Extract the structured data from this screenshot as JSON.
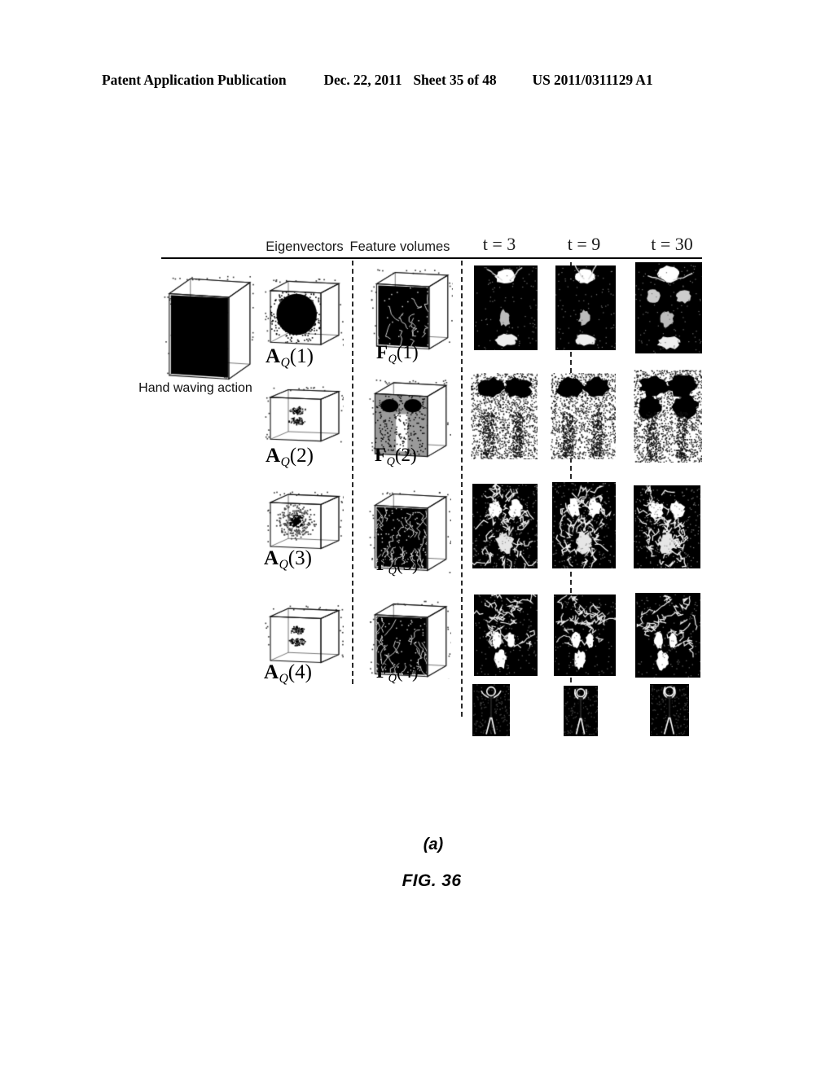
{
  "header": {
    "publication": "Patent Application Publication",
    "date": "Dec. 22, 2011",
    "sheet": "Sheet 35 of 48",
    "number": "US 2011/0311129 A1"
  },
  "figure": {
    "column_headers": {
      "eigenvectors": "Eigenvectors",
      "feature_volumes": "Feature volumes",
      "t3": "t = 3",
      "t9": "t = 9",
      "t30": "t = 30"
    },
    "action_label": "Hand waving action",
    "rows": [
      {
        "eigen_label_base": "A",
        "eigen_label_sub": "Q",
        "eigen_label_index": "(1)",
        "feature_label_base": "F",
        "feature_label_sub": "Q",
        "feature_label_index": "(1)",
        "frame_style": "dark-blobs"
      },
      {
        "eigen_label_base": "A",
        "eigen_label_sub": "Q",
        "eigen_label_index": "(2)",
        "feature_label_base": "F",
        "feature_label_sub": "Q",
        "feature_label_index": "(2)",
        "frame_style": "inverted-noise"
      },
      {
        "eigen_label_base": "A",
        "eigen_label_sub": "Q",
        "eigen_label_index": "(3)",
        "feature_label_base": "F",
        "feature_label_sub": "Q",
        "feature_label_index": "(3)",
        "frame_style": "bright-edges"
      },
      {
        "eigen_label_base": "A",
        "eigen_label_sub": "Q",
        "eigen_label_index": "(4)",
        "feature_label_base": "F",
        "feature_label_sub": "Q",
        "feature_label_index": "(4)",
        "frame_style": "sparse-edges"
      },
      {
        "eigen_label_base": "",
        "eigen_label_sub": "",
        "eigen_label_index": "",
        "feature_label_base": "",
        "feature_label_sub": "",
        "feature_label_index": "",
        "frame_style": "silhouette"
      }
    ]
  },
  "caption": {
    "subfigure": "(a)",
    "figure_number": "FIG. 36"
  },
  "colors": {
    "ink": "#000000",
    "paper": "#ffffff",
    "rule": "#000000"
  }
}
